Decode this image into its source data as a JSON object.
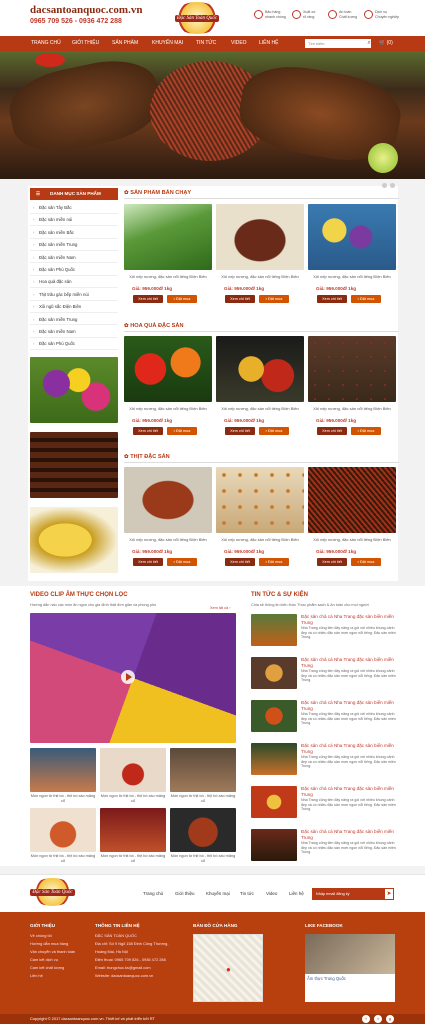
{
  "header": {
    "site": "dacsantoanquoc.com.vn",
    "hotline": "0965 709 526 - 0936 472 288",
    "logo_text": "Đặc Sản Toàn Quốc",
    "services": [
      {
        "icon": "quality-icon",
        "l1": "Bảo hàng",
        "l2": "nhanh chóng"
      },
      {
        "icon": "truck-icon",
        "l1": "Xuất xứ",
        "l2": "rõ ràng"
      },
      {
        "icon": "safety-icon",
        "l1": "An toàn",
        "l2": "Chất lượng"
      },
      {
        "icon": "service-icon",
        "l1": "Dịch vụ",
        "l2": "Chuyên nghiệp"
      }
    ]
  },
  "nav": {
    "items": [
      "TRANG CHỦ",
      "GIỚI THIỆU",
      "SẢN PHẨM",
      "KHUYẾN MẠI",
      "TIN TỨC",
      "VIDEO",
      "LIÊN HỆ"
    ],
    "search_placeholder": "Tìm kiếm",
    "cart": "(0)"
  },
  "sidebar": {
    "title": "DANH MỤC SẢN PHẨM",
    "items": [
      "Đặc sản Tây Bắc",
      "Đặc sản miền núi",
      "Đặc sản miền Bắc",
      "Đặc sản miền Trung",
      "Đặc sản miền Nam",
      "Đặc sản Phú Quốc",
      "Hoa quả đặc sản",
      "Thịt trâu gác bếp miền núi",
      "Xôi ngũ sắc Điện Biên",
      "Đặc sản miền Trung",
      "Đặc sản miền Nam",
      "Đặc sản Phú Quốc"
    ]
  },
  "sections": [
    {
      "title": "SẢN PHẨM BÁN CHẠY"
    },
    {
      "title": "HOA QUẢ ĐẶC SẢN"
    },
    {
      "title": "THỊT ĐẶC SẢN"
    }
  ],
  "product": {
    "name": "Xôi nếp nương, đặc sản nổi tiếng Điện Biên",
    "price": "Giá: 959.000đ/ 1kg",
    "detail_btn": "Xem chi tiết",
    "buy_btn": "Đặt mua"
  },
  "video": {
    "title": "VIDEO CLIP ẨM THỰC CHỌN LỌC",
    "desc": "Hướng dẫn nấu các món ăn ngon cho gia đình thật đơn giản và phong phú",
    "more": "Xem tất cả",
    "caption": "Món ngon từ thịt bò - thịt bò xào măng cổ"
  },
  "news": {
    "title": "TIN TỨC & SỰ KIỆN",
    "desc": "Chia sẻ thông tin kiến thức Thực phẩm sạch & An toàn cho mọi người",
    "item_title": "Đặc sản chả cá Nha Trang đặc sản biển miền Trung",
    "item_desc": "Nha Trang cũng tiền đây năng ra gói với nhiều khung cảnh đẹp và có nhiều đặc sản mơn ngon nổi tiếng. Đặc sản miền Trung."
  },
  "footer_nav": {
    "items": [
      "Trang chủ",
      "Giới thiệu",
      "Khuyến mại",
      "Tin tức",
      "Video",
      "Liên hệ"
    ],
    "email_placeholder": "Nhập email đăng ký"
  },
  "footer": {
    "col1_title": "GIỚI THIỆU",
    "col1_items": [
      "Về chúng tôi",
      "Hướng dẫn mua hàng",
      "Vận chuyển và thanh toán",
      "Cam kết dịch vụ",
      "Cam kết chất lượng",
      "Liên hệ"
    ],
    "col2_title": "THÔNG TIN LIÊN HỆ",
    "col2_items": [
      "ĐẶC SẢN TOÀN QUỐC",
      "Địa chỉ: Số 9 Ngõ 158 Đinh Công Thượng,",
      "Hoàng Mai, Hà Nội",
      "Điện thoại: 0965 709 526 - 0936 472 288",
      "Email: trungchuc.ks@gmail.com",
      "Website: dacsantoanquoc.com.vn"
    ],
    "col3_title": "BẢN ĐỒ CỬA HÀNG",
    "col4_title": "LIKE FACEBOOK",
    "fb_page": "Ẩm thực Trung Quốc",
    "copyright": "Copyright © 2017 dacsantoanquoc.com.vn. Thiết kế và phát triển bởi RT"
  },
  "colors": {
    "brand": "#b83a14",
    "accent": "#c0392b",
    "footer": "#b8400f"
  }
}
